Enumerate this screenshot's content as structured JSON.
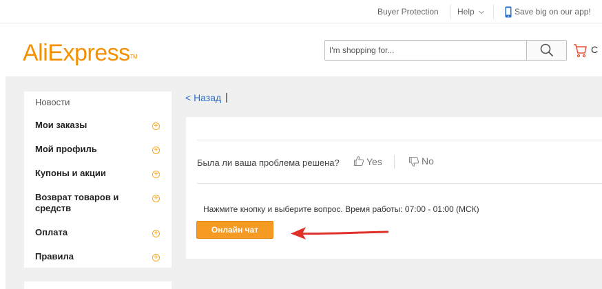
{
  "topbar": {
    "buyer_protection": "Buyer Protection",
    "help": "Help",
    "app_promo": "Save big on our app!"
  },
  "header": {
    "logo": "AliExpress",
    "logo_tm": "TM",
    "search_placeholder": "I'm shopping for...",
    "cart_label": "C"
  },
  "sidebar": {
    "news": "Новости",
    "items": [
      {
        "label": "Мои заказы"
      },
      {
        "label": "Мой профиль"
      },
      {
        "label": "Купоны и акции"
      },
      {
        "label": "Возврат товаров и средств"
      },
      {
        "label": "Оплата"
      },
      {
        "label": "Правила"
      }
    ]
  },
  "main": {
    "back_link": "< Назад",
    "back_sep": "|",
    "feedback_question": "Была ли ваша проблема решена?",
    "yes_label": "Yes",
    "no_label": "No",
    "instructions": "Нажмите кнопку и выберите вопрос. Время работы: 07:00 - 01:00 (МСК)",
    "chat_button": "Онлайн чат"
  },
  "colors": {
    "brand_orange": "#f59100",
    "button_orange": "#f59a23",
    "link_blue": "#2a6ecd",
    "arrow_red": "#e0302a"
  }
}
